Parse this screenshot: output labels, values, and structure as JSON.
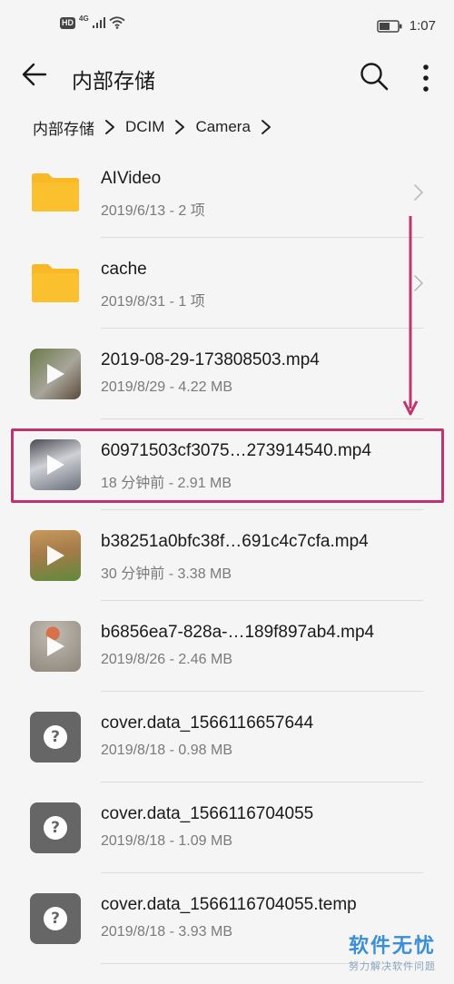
{
  "status_bar": {
    "hd": "HD",
    "network": "4G",
    "time": "1:07"
  },
  "app_bar": {
    "title": "内部存储"
  },
  "breadcrumb": [
    "内部存储",
    "DCIM",
    "Camera"
  ],
  "files": [
    {
      "type": "folder",
      "name": "AIVideo",
      "meta": "2019/6/13 - 2 项",
      "icon": "folder-icon"
    },
    {
      "type": "folder",
      "name": "cache",
      "meta": "2019/8/31 - 1 项",
      "icon": "folder-icon"
    },
    {
      "type": "video",
      "name": "2019-08-29-173808503.mp4",
      "meta": "2019/8/29 - 4.22 MB",
      "icon": "video-thumbnail",
      "colors": [
        "#6b7a4a",
        "#a8a59a"
      ]
    },
    {
      "type": "video",
      "name": "60971503cf3075…273914540.mp4",
      "meta": "18 分钟前 - 2.91 MB",
      "icon": "video-thumbnail",
      "colors": [
        "#4a4a52",
        "#cfd1d6"
      ]
    },
    {
      "type": "video",
      "name": "b38251a0bfc38f…691c4c7cfa.mp4",
      "meta": "30 分钟前 - 3.38 MB",
      "icon": "video-thumbnail",
      "colors": [
        "#a67b4a",
        "#5f8a3c"
      ]
    },
    {
      "type": "video",
      "name": "b6856ea7-828a-…189f897ab4.mp4",
      "meta": "2019/8/26 - 2.46 MB",
      "icon": "video-thumbnail",
      "colors": [
        "#8e8579",
        "#b9b3aa"
      ]
    },
    {
      "type": "unknown",
      "name": "cover.data_1566116657644",
      "meta": "2019/8/18 - 0.98 MB",
      "icon": "unknown-file-icon"
    },
    {
      "type": "unknown",
      "name": "cover.data_1566116704055",
      "meta": "2019/8/18 - 1.09 MB",
      "icon": "unknown-file-icon"
    },
    {
      "type": "unknown",
      "name": "cover.data_1566116704055.temp",
      "meta": "2019/8/18 - 3.93 MB",
      "icon": "unknown-file-icon"
    }
  ],
  "annotation": {
    "highlight_color": "#c1336f"
  },
  "watermark": {
    "title": "软件无忧",
    "subtitle": "努力解决软件问题"
  },
  "colors": {
    "folder": "#f9b826",
    "background": "#f5f5f5"
  }
}
